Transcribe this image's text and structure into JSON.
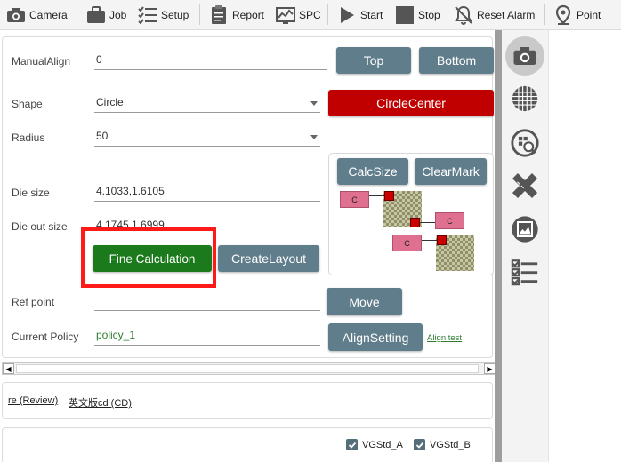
{
  "toolbar": {
    "camera": "Camera",
    "job": "Job",
    "setup": "Setup",
    "report": "Report",
    "spc": "SPC",
    "start": "Start",
    "stop": "Stop",
    "reset_alarm": "Reset Alarm",
    "point": "Point"
  },
  "form": {
    "manual_align_label": "ManualAlign",
    "manual_align_value": "0",
    "shape_label": "Shape",
    "shape_value": "Circle",
    "radius_label": "Radius",
    "radius_value": "50",
    "die_size_label": "Die size",
    "die_size_value": "4.1033,1.6105",
    "die_out_size_label": "Die out size",
    "die_out_size_value": "4.1745,1.6999",
    "ref_point_label": "Ref point",
    "ref_point_value": "",
    "current_policy_label": "Current Policy",
    "current_policy_value": "policy_1"
  },
  "buttons": {
    "top": "Top",
    "bottom": "Bottom",
    "circle_center": "CircleCenter",
    "calc_size": "CalcSize",
    "clear_mark": "ClearMark",
    "fine_calculation": "Fine Calculation",
    "create_layout": "CreateLayout",
    "move": "Move",
    "align_setting": "AlignSetting",
    "align_test": "Align test"
  },
  "diagram": {
    "pin_label": "C"
  },
  "jobs": {
    "tab1": "re (Review)",
    "tab2": "英文版cd (CD)"
  },
  "standards": {
    "a": "VGStd_A",
    "b": "VGStd_B",
    "a_checked": true,
    "b_checked": true
  },
  "colors": {
    "button": "#607d8b",
    "circle_center": "#c00000",
    "fine_calculation": "#1b7a1b",
    "highlight": "#ff1a1a"
  }
}
